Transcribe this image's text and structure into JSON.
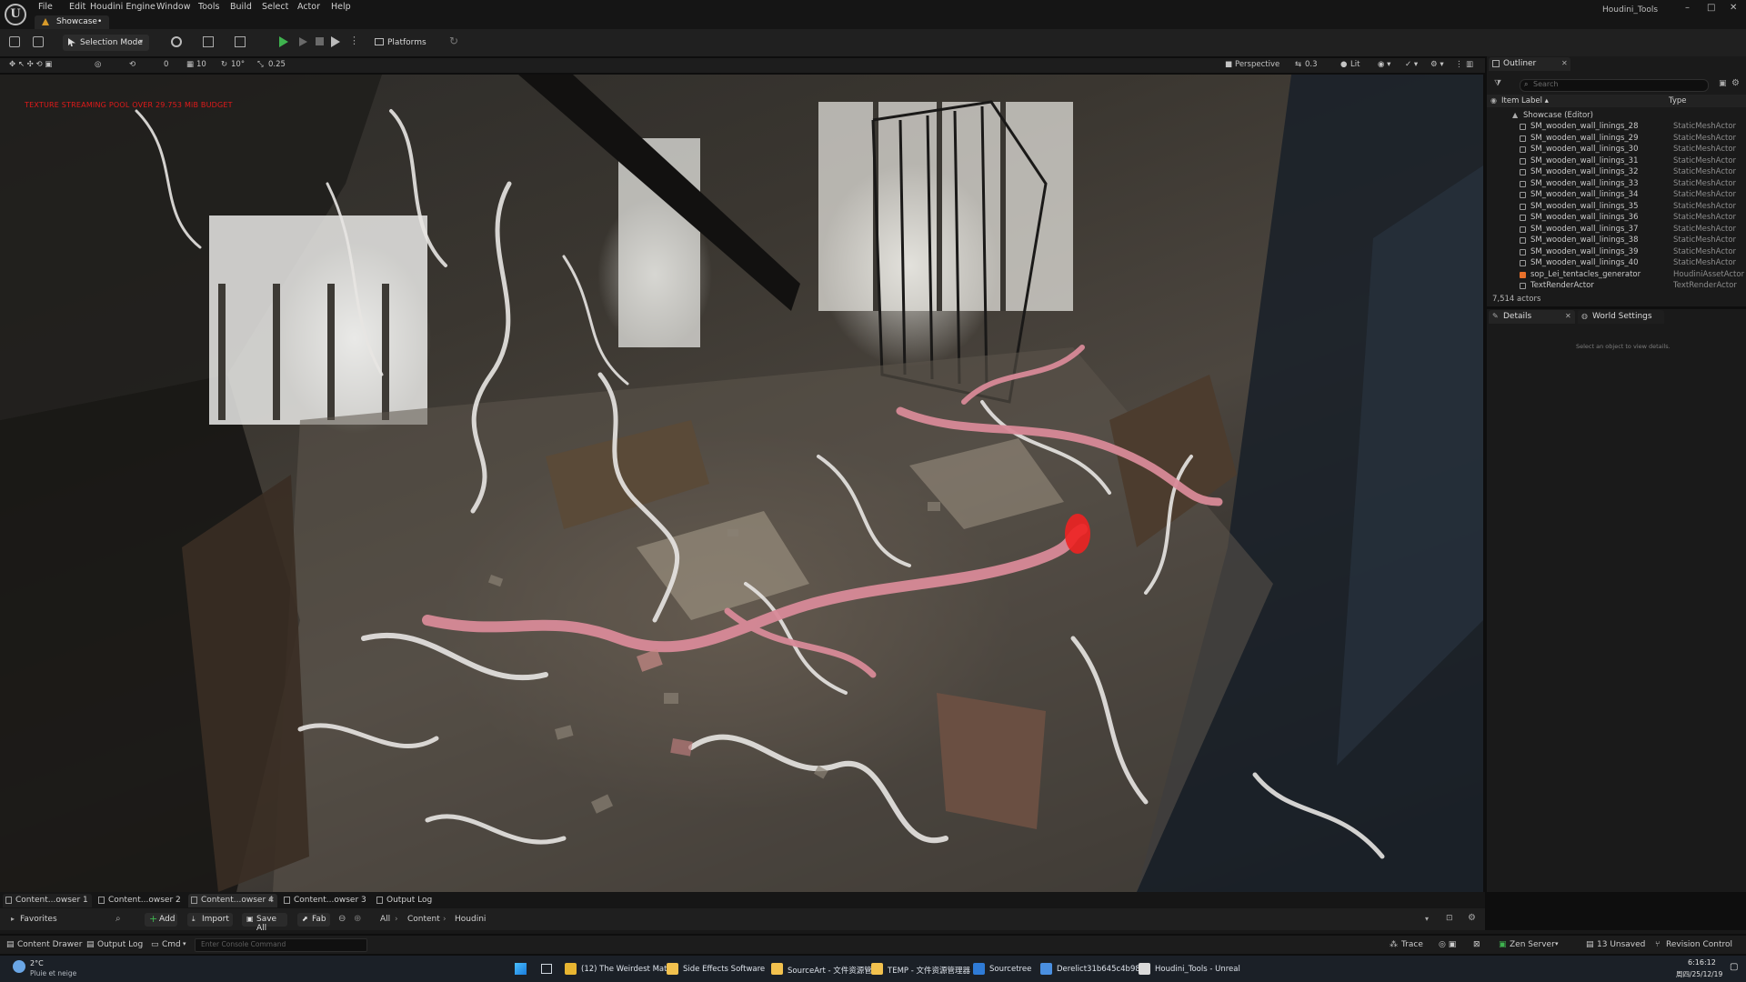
{
  "window": {
    "app_title": "Houdini_Tools",
    "doc_tab": "Showcase•",
    "controls": [
      "–",
      "□",
      "✕"
    ]
  },
  "menu": [
    "File",
    "Edit",
    "Houdini Engine",
    "Window",
    "Tools",
    "Build",
    "Select",
    "Actor",
    "Help"
  ],
  "toolbar": {
    "selection_mode": "Selection Mode",
    "platforms": "Platforms"
  },
  "viewport_toolbar": {
    "snap_rotation": "0",
    "grid_size": "10",
    "rotation_snap": "10°",
    "scale_snap": "0.25",
    "view_mode": "Perspective",
    "camera_speed": "0.3",
    "lighting": "Lit"
  },
  "viewport": {
    "warning": "TEXTURE STREAMING POOL OVER 29.753 MiB BUDGET"
  },
  "outliner": {
    "tab_label": "Outliner",
    "search_placeholder": "Search",
    "col_label": "Item Label ▴",
    "col_type": "Type",
    "root": "Showcase (Editor)",
    "rows": [
      {
        "name": "SM_wooden_wall_linings_28",
        "type": "StaticMeshActor"
      },
      {
        "name": "SM_wooden_wall_linings_29",
        "type": "StaticMeshActor"
      },
      {
        "name": "SM_wooden_wall_linings_30",
        "type": "StaticMeshActor"
      },
      {
        "name": "SM_wooden_wall_linings_31",
        "type": "StaticMeshActor"
      },
      {
        "name": "SM_wooden_wall_linings_32",
        "type": "StaticMeshActor"
      },
      {
        "name": "SM_wooden_wall_linings_33",
        "type": "StaticMeshActor"
      },
      {
        "name": "SM_wooden_wall_linings_34",
        "type": "StaticMeshActor"
      },
      {
        "name": "SM_wooden_wall_linings_35",
        "type": "StaticMeshActor"
      },
      {
        "name": "SM_wooden_wall_linings_36",
        "type": "StaticMeshActor"
      },
      {
        "name": "SM_wooden_wall_linings_37",
        "type": "StaticMeshActor"
      },
      {
        "name": "SM_wooden_wall_linings_38",
        "type": "StaticMeshActor"
      },
      {
        "name": "SM_wooden_wall_linings_39",
        "type": "StaticMeshActor"
      },
      {
        "name": "SM_wooden_wall_linings_40",
        "type": "StaticMeshActor"
      },
      {
        "name": "sop_Lei_tentacles_generator",
        "type": "HoudiniAssetActor"
      },
      {
        "name": "TextRenderActor",
        "type": "TextRenderActor"
      }
    ],
    "actor_count": "7,514 actors"
  },
  "details": {
    "tab_label": "Details",
    "world_settings": "World Settings",
    "hint": "Select an object to view details."
  },
  "drawer": {
    "tabs": [
      "Content...owser 1",
      "Content...owser 2",
      "Content...owser 4",
      "Content...owser 3",
      "Output Log"
    ],
    "favorites": "Favorites",
    "add": "Add",
    "import": "Import",
    "save_all": "Save All",
    "fab": "Fab",
    "path": [
      "All",
      "Content",
      "Houdini"
    ]
  },
  "statusbar": {
    "content_drawer": "Content Drawer",
    "output_log": "Output Log",
    "cmd": "Cmd",
    "console_placeholder": "Enter Console Command",
    "trace": "Trace",
    "zen_server": "Zen Server",
    "unsaved": "13 Unsaved",
    "revision_control": "Revision Control"
  },
  "taskbar": {
    "weather_temp": "2°C",
    "weather_desc": "Pluie et neige",
    "apps": [
      {
        "label": "(12) The Weirdest Mate",
        "color": "#e8b531"
      },
      {
        "label": "Side Effects Software",
        "color": "#f2c14e"
      },
      {
        "label": "SourceArt - 文件资源管",
        "color": "#f2c14e"
      },
      {
        "label": "TEMP - 文件资源管理器",
        "color": "#f2c14e"
      },
      {
        "label": "Sourcetree",
        "color": "#2f7bd6"
      },
      {
        "label": "Derelict31b645c4b988",
        "color": "#4a8fe0"
      },
      {
        "label": "Houdini_Tools - Unreal",
        "color": "#dadada"
      }
    ],
    "time": "6:16:12",
    "date": "周四/25/12/19"
  },
  "colors": {
    "play": "#3fb34f",
    "warning": "#e21a1a",
    "houdini_icon": "#e8702a"
  }
}
